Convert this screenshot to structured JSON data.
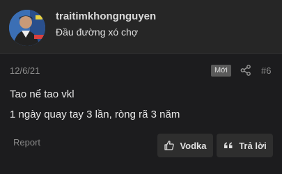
{
  "author": {
    "username": "traitimkhongnguyen",
    "title": "Đầu đường xó chợ",
    "avatar_icon": "user-avatar-photo"
  },
  "post": {
    "date": "12/6/21",
    "badge": "Mới",
    "number": "#6",
    "lines": [
      "Tao nể tao vkl",
      "1 ngày quay tay 3 lần, ròng rã 3 năm"
    ]
  },
  "actions": {
    "report": "Report",
    "like": "Vodka",
    "reply": "Trả lời"
  },
  "colors": {
    "background": "#1c1c1e",
    "header": "#262626",
    "button": "#2e2e2e"
  }
}
